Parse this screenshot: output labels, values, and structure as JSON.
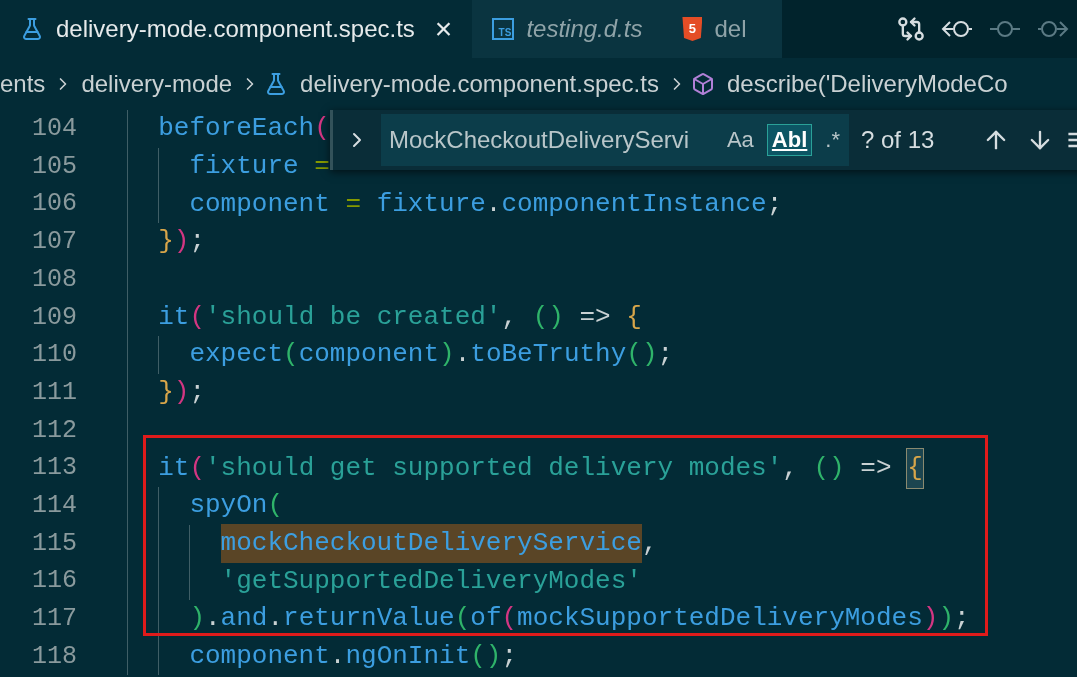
{
  "tabs": [
    {
      "label": "delivery-mode.component.spec.ts",
      "kind": "flask",
      "selected": true,
      "italic": false,
      "close": "×"
    },
    {
      "label": "testing.d.ts",
      "kind": "ts",
      "icon_text": "TS",
      "selected": false,
      "italic": true
    },
    {
      "label": "del",
      "kind": "html",
      "icon_text": "5",
      "selected": false,
      "italic": false
    }
  ],
  "toolbar": [
    {
      "kind": "compare",
      "disabled": false
    },
    {
      "kind": "back",
      "disabled": false
    },
    {
      "kind": "dot",
      "disabled": true
    },
    {
      "kind": "forward",
      "disabled": true
    }
  ],
  "breadcrumbs": [
    {
      "label": "ents",
      "kind": "folder"
    },
    {
      "label": "delivery-mode",
      "kind": "folder"
    },
    {
      "label": "delivery-mode.component.spec.ts",
      "kind": "flask"
    },
    {
      "label": "describe('DeliveryModeCo",
      "kind": "cube"
    }
  ],
  "find_widget": {
    "query": "MockCheckoutDeliveryServi",
    "options": [
      {
        "label": "Aa",
        "on": false
      },
      {
        "label": "Abl",
        "on": true
      },
      {
        "label": ".*",
        "on": false
      }
    ],
    "match_count": "? of 13"
  },
  "lines": [
    {
      "number": "104",
      "tokens": [
        {
          "text": "beforeEach",
          "kind": "fn"
        },
        {
          "text": "(",
          "kind": "p1"
        }
      ],
      "children": [
        {
          "number": "105",
          "tokens": [
            {
              "text": "fixture",
              "kind": "var"
            },
            {
              "text": "=",
              "kind": "op"
            }
          ]
        },
        {
          "number": "106",
          "tokens": [
            {
              "text": "component",
              "kind": "var"
            },
            {
              "text": "=",
              "kind": "op"
            },
            {
              "text": "fixture",
              "kind": "var"
            },
            {
              "text": ".",
              "kind": "plain"
            },
            {
              "text": "componentInstance",
              "kind": "var"
            },
            {
              "text": ";",
              "kind": "plain"
            }
          ]
        }
      ]
    },
    {
      "number": "107",
      "tokens": [
        {
          "text": "}",
          "kind": "b1"
        },
        {
          "text": ")",
          "kind": "p1"
        },
        {
          "text": ";",
          "kind": "plain"
        }
      ]
    },
    {
      "number": "108"
    },
    {
      "number": "109",
      "tokens": [
        {
          "text": "it",
          "kind": "fn"
        },
        {
          "text": "(",
          "kind": "p1"
        },
        {
          "text": "'should be created'",
          "kind": "str"
        },
        {
          "text": ",",
          "kind": "plain"
        },
        {
          "text": "()",
          "kind": "p2"
        },
        {
          "text": "=>",
          "kind": "plain"
        },
        {
          "text": "{",
          "kind": "b1"
        }
      ],
      "children": [
        {
          "number": "110",
          "tokens": [
            {
              "text": "expect",
              "kind": "fn"
            },
            {
              "text": "(",
              "kind": "p2"
            },
            {
              "text": "component",
              "kind": "var"
            },
            {
              "text": ")",
              "kind": "p2"
            },
            {
              "text": ".",
              "kind": "plain"
            },
            {
              "text": "toBeTruthy",
              "kind": "fn"
            },
            {
              "text": "()",
              "kind": "p2"
            },
            {
              "text": ";",
              "kind": "plain"
            }
          ]
        }
      ]
    },
    {
      "number": "111",
      "tokens": [
        {
          "text": "}",
          "kind": "b1"
        },
        {
          "text": ")",
          "kind": "p1"
        },
        {
          "text": ";",
          "kind": "plain"
        }
      ]
    },
    {
      "number": "112"
    },
    {
      "number": "113",
      "tokens": [
        {
          "text": "it",
          "kind": "fn"
        },
        {
          "text": "(",
          "kind": "p1"
        },
        {
          "text": "'should get supported delivery modes'",
          "kind": "str"
        },
        {
          "text": ",",
          "kind": "plain"
        },
        {
          "text": "()",
          "kind": "p2"
        },
        {
          "text": "=>",
          "kind": "plain"
        },
        {
          "text": "{",
          "kind": "brace_match"
        }
      ],
      "children": [
        {
          "number": "114",
          "tokens": [
            {
              "text": "spyOn",
              "kind": "fn"
            },
            {
              "text": "(",
              "kind": "p2"
            }
          ],
          "children": [
            {
              "number": "115",
              "tokens": [
                {
                  "text": "mockCheckoutDeliveryService",
                  "kind": "match"
                },
                {
                  "text": ",",
                  "kind": "plain"
                }
              ]
            },
            {
              "number": "116",
              "tokens": [
                {
                  "text": "'getSupportedDeliveryModes'",
                  "kind": "str"
                }
              ]
            }
          ]
        },
        {
          "number": "117",
          "tokens": [
            {
              "text": ")",
              "kind": "p2"
            },
            {
              "text": ".",
              "kind": "plain"
            },
            {
              "text": "and",
              "kind": "var"
            },
            {
              "text": ".",
              "kind": "plain"
            },
            {
              "text": "returnValue",
              "kind": "fn"
            },
            {
              "text": "(",
              "kind": "p2"
            },
            {
              "text": "of",
              "kind": "fn"
            },
            {
              "text": "(",
              "kind": "p1"
            },
            {
              "text": "mockSupportedDeliveryModes",
              "kind": "var"
            },
            {
              "text": ")",
              "kind": "p1"
            },
            {
              "text": ")",
              "kind": "p2"
            },
            {
              "text": ";",
              "kind": "plain"
            }
          ]
        },
        {
          "number": "118",
          "tokens": [
            {
              "text": "component",
              "kind": "var"
            },
            {
              "text": ".",
              "kind": "plain"
            },
            {
              "text": "ngOnInit",
              "kind": "fn"
            },
            {
              "text": "()",
              "kind": "p2"
            },
            {
              "text": ";",
              "kind": "plain"
            }
          ]
        }
      ]
    }
  ]
}
